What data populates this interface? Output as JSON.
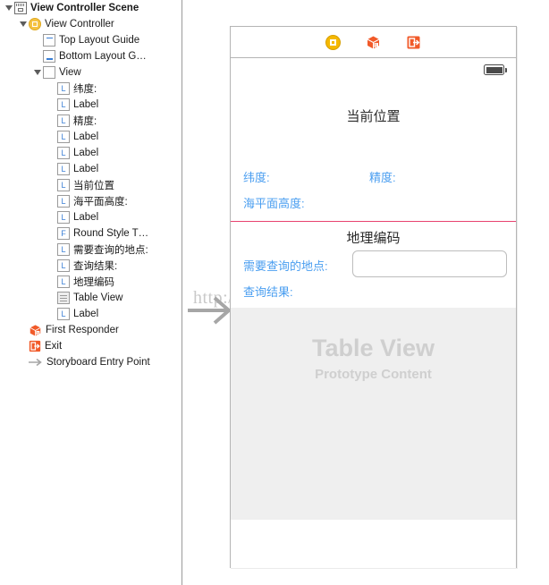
{
  "outline": {
    "rows": [
      {
        "label": "View Controller Scene",
        "icon": "scene-icon",
        "indent": 0,
        "disclosure": "open",
        "bold": true
      },
      {
        "label": "View Controller",
        "icon": "view-controller-icon",
        "indent": 1,
        "disclosure": "open",
        "bold": false
      },
      {
        "label": "Top Layout Guide",
        "icon": "top-layout-guide-icon",
        "indent": 2,
        "disclosure": "none",
        "bold": false
      },
      {
        "label": "Bottom Layout G…",
        "icon": "bottom-layout-guide-icon",
        "indent": 2,
        "disclosure": "none",
        "bold": false
      },
      {
        "label": "View",
        "icon": "view-icon",
        "indent": 2,
        "disclosure": "open",
        "bold": false
      },
      {
        "label": "纬度:",
        "icon": "label-icon",
        "indent": 3,
        "disclosure": "none",
        "bold": false
      },
      {
        "label": "Label",
        "icon": "label-icon",
        "indent": 3,
        "disclosure": "none",
        "bold": false
      },
      {
        "label": "精度:",
        "icon": "label-icon",
        "indent": 3,
        "disclosure": "none",
        "bold": false
      },
      {
        "label": "Label",
        "icon": "label-icon",
        "indent": 3,
        "disclosure": "none",
        "bold": false
      },
      {
        "label": "Label",
        "icon": "label-icon",
        "indent": 3,
        "disclosure": "none",
        "bold": false
      },
      {
        "label": "Label",
        "icon": "label-icon",
        "indent": 3,
        "disclosure": "none",
        "bold": false
      },
      {
        "label": "当前位置",
        "icon": "label-icon",
        "indent": 3,
        "disclosure": "none",
        "bold": false
      },
      {
        "label": "海平面高度:",
        "icon": "label-icon",
        "indent": 3,
        "disclosure": "none",
        "bold": false
      },
      {
        "label": "Label",
        "icon": "label-icon",
        "indent": 3,
        "disclosure": "none",
        "bold": false
      },
      {
        "label": "Round Style T…",
        "icon": "textfield-icon",
        "indent": 3,
        "disclosure": "none",
        "bold": false
      },
      {
        "label": "需要查询的地点:",
        "icon": "label-icon",
        "indent": 3,
        "disclosure": "none",
        "bold": false
      },
      {
        "label": "查询结果:",
        "icon": "label-icon",
        "indent": 3,
        "disclosure": "none",
        "bold": false
      },
      {
        "label": "地理编码",
        "icon": "label-icon",
        "indent": 3,
        "disclosure": "none",
        "bold": false
      },
      {
        "label": "Table View",
        "icon": "table-view-icon",
        "indent": 3,
        "disclosure": "none",
        "bold": false
      },
      {
        "label": "Label",
        "icon": "label-icon",
        "indent": 3,
        "disclosure": "none",
        "bold": false
      },
      {
        "label": "First Responder",
        "icon": "first-responder-icon",
        "indent": 1,
        "disclosure": "none",
        "bold": false
      },
      {
        "label": "Exit",
        "icon": "exit-icon",
        "indent": 1,
        "disclosure": "none",
        "bold": false
      },
      {
        "label": "Storyboard Entry Point",
        "icon": "entry-point-arrow-icon",
        "indent": 1,
        "disclosure": "none",
        "bold": false
      }
    ],
    "letter_label": "L",
    "letter_textfield": "F"
  },
  "canvas": {
    "watermark": "http://blog.csdn.net/",
    "scene_dock": {
      "view_controller_label": "View Controller",
      "first_responder_label": "First Responder",
      "exit_label": "Exit"
    },
    "phone": {
      "title_current_location": "当前位置",
      "label_latitude": "纬度:",
      "label_longitude": "精度:",
      "label_altitude": "海平面高度:",
      "title_geocoding": "地理编码",
      "label_query_place": "需要查询的地点:",
      "label_query_result": "查询结果:",
      "query_input_value": "",
      "query_input_placeholder": "",
      "table_view_title": "Table View",
      "table_view_subtitle": "Prototype Content"
    }
  },
  "colors": {
    "label_blue": "#4a9ef0",
    "divider_pink": "#e8436f",
    "accent_yellow": "#f5b800",
    "accent_orange": "#f15a29",
    "table_bg": "#efefef"
  }
}
